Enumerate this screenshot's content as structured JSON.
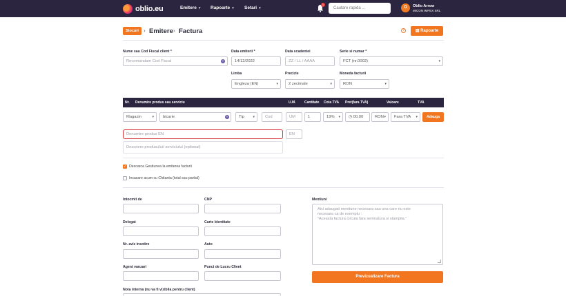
{
  "nav": {
    "logo_text": "oblio.eu",
    "menu": [
      {
        "label": "Emitere",
        "chevron": "▾"
      },
      {
        "label": "Rapoarte",
        "chevron": "▾"
      },
      {
        "label": "Setari",
        "chevron": "▾"
      }
    ],
    "notification_count": "1",
    "search_placeholder": "Cautare rapida ...",
    "user": {
      "initial": "O",
      "name": "Oblio Arrow",
      "company": "MICON IMPEX SRL"
    }
  },
  "header": {
    "stocuri_button": "Stocuri",
    "breadcrumb": [
      "Emitere",
      "Factura"
    ],
    "separator": "›",
    "help": "?",
    "rapoarte_button": "Rapoarte"
  },
  "form": {
    "client": {
      "label": "Nume sau Cod Fiscal client *",
      "placeholder": "Recomandam Cod Fiscal"
    },
    "issue_date": {
      "label": "Data emiterii *",
      "value": "14/12/2022"
    },
    "due_date": {
      "label": "Data scadentei",
      "placeholder": "ZZ / LL / AAAA"
    },
    "series": {
      "label": "Serie si numar *",
      "value": "FCT (nr.0002)"
    },
    "language": {
      "label": "Limba",
      "value": "Engleza (EN)"
    },
    "precision": {
      "label": "Precizie",
      "value": "2 zecimale"
    },
    "currency": {
      "label": "Moneda facturii",
      "value": "RON"
    }
  },
  "products": {
    "columns": [
      "Nr.",
      "Denumire produs sau serviciu",
      "U.M.",
      "Cantitate",
      "Cota TVA",
      "Pret(fara TVA)",
      "Valoare",
      "TVA"
    ],
    "row": {
      "management": "Magazin",
      "product": "bicarie",
      "type": "Tip",
      "code": "Cod",
      "unit": "UM",
      "quantity": "1",
      "vat_rate": "19%",
      "price": "00.00",
      "currency": "RON",
      "vat_mode": "Fara TVA",
      "add_button": "Adauga"
    },
    "name_en_placeholder": "Denumire produs EN",
    "lang_tag": "EN",
    "description_placeholder": "Descriere produsului/ serviciului (optional)"
  },
  "options": {
    "discount": {
      "label": "Descarca Gestiunea la emiterea facturii",
      "checked": true
    },
    "cash": {
      "label": "Incasare acum cu Chitanta (total sau partial)",
      "checked": false
    }
  },
  "delegate": {
    "drawn_up_by": "Intocmit de",
    "cnp": "CNP",
    "delegate": "Delegat",
    "id_card": "Carte Identitate",
    "shipping_notice": "Nr. aviz insotire",
    "auto": "Auto",
    "sales_agent": "Agent vanzari",
    "work_point": "Punct de Lucru Client",
    "internal_note": "Nota interna (nu va fi vizibila pentru client)"
  },
  "mentions": {
    "label": "Mentiuni",
    "placeholder_lines": [
      "Aici adaugati mentiune necesara sau una care nu este",
      "necesara ca de exemplu :",
      "\"Aceasta factura circula fara semnatura si stampila.\""
    ]
  },
  "preview_button": "Previzualizare Factura",
  "colors": {
    "nav_bg": "#2c2540",
    "accent": "#f2761f",
    "focus_border": "#d9343a",
    "clear_icon": "#6a5aa8"
  }
}
